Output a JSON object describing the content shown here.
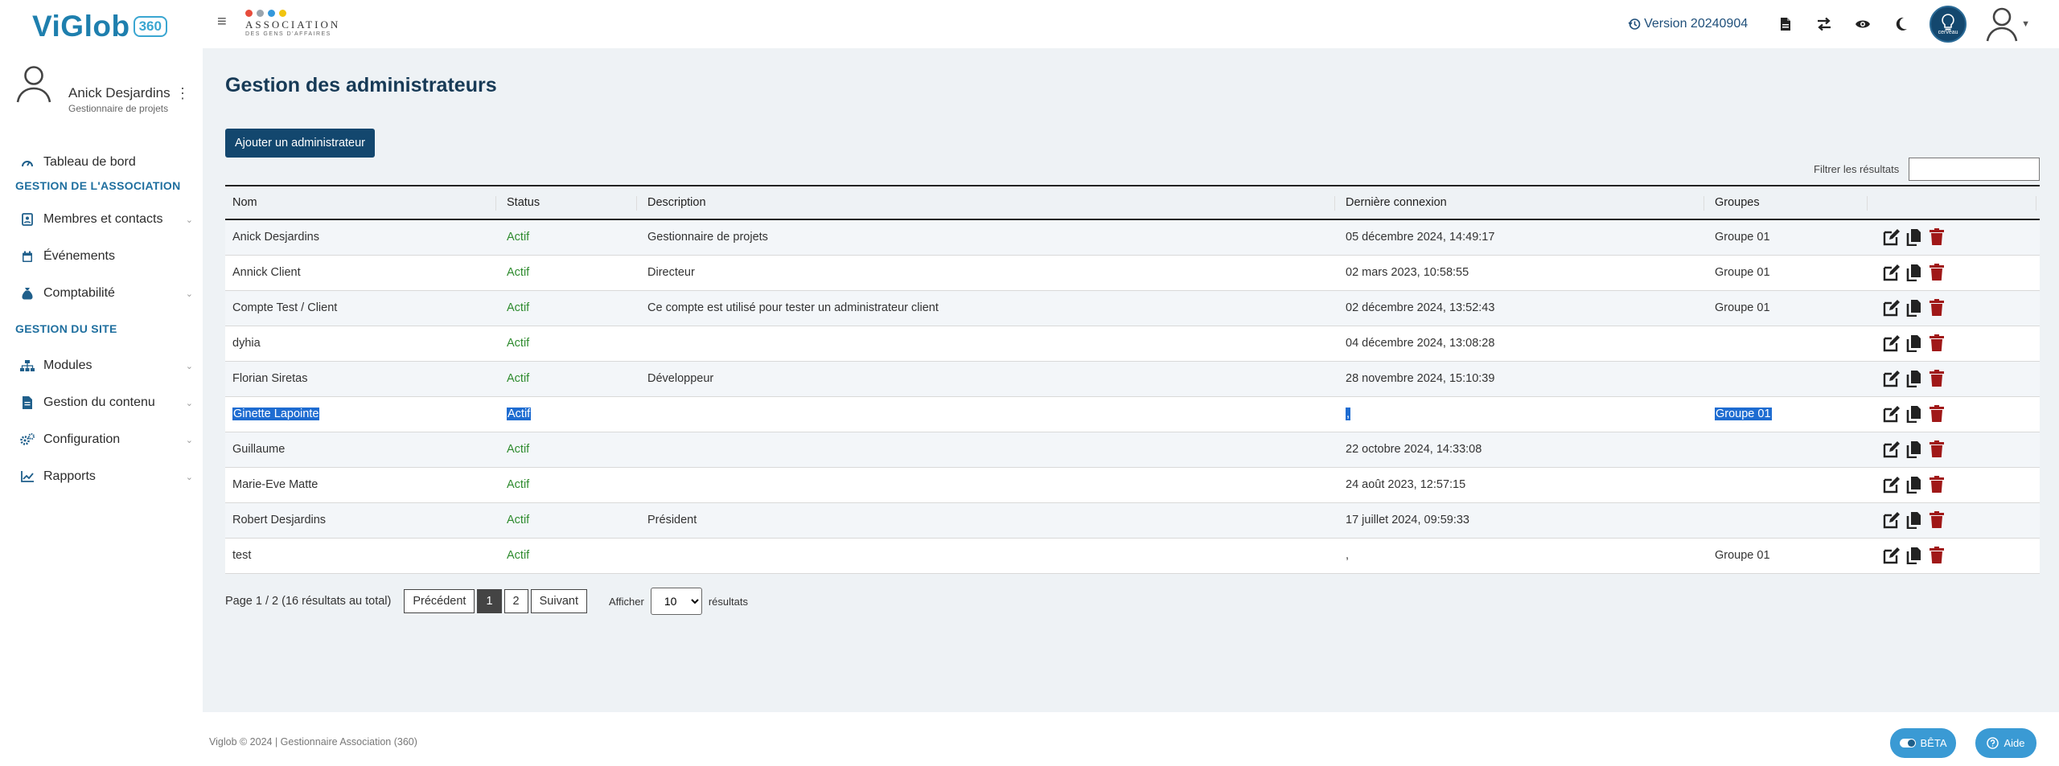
{
  "header": {
    "logo_text": "ViGlob",
    "logo_badge": "360",
    "assoc_name": "ASSOCIATION",
    "assoc_sub": "DES GENS D'AFFAIRES",
    "version": "Version 20240904",
    "cerveau_label": "cerveau",
    "dot_colors": [
      "#e74c3c",
      "#9aa4ad",
      "#3498db",
      "#f1c40f"
    ]
  },
  "sidebar": {
    "user_name": "Anick Desjardins",
    "user_role": "Gestionnaire de projets",
    "items": [
      {
        "label": "Tableau de bord",
        "icon": "gauge-icon"
      },
      {
        "label": "Membres et contacts",
        "icon": "contact-card-icon"
      },
      {
        "label": "Événements",
        "icon": "calendar-icon"
      },
      {
        "label": "Comptabilité",
        "icon": "money-bag-icon"
      },
      {
        "label": "Modules",
        "icon": "sitemap-icon"
      },
      {
        "label": "Gestion du contenu",
        "icon": "file-icon"
      },
      {
        "label": "Configuration",
        "icon": "cogs-icon"
      },
      {
        "label": "Rapports",
        "icon": "chart-line-icon"
      }
    ],
    "sections": [
      "GESTION DE L'ASSOCIATION",
      "GESTION DU SITE"
    ]
  },
  "main": {
    "title": "Gestion des administrateurs",
    "add_button": "Ajouter un administrateur",
    "filter_label": "Filtrer les résultats",
    "filter_value": "",
    "columns": [
      "Nom",
      "Status",
      "Description",
      "Dernière connexion",
      "Groupes"
    ],
    "rows": [
      {
        "nom": "Anick Desjardins",
        "status": "Actif",
        "description": "Gestionnaire de projets",
        "connexion": "05 décembre 2024, 14:49:17",
        "groupes": "Groupe 01"
      },
      {
        "nom": "Annick Client",
        "status": "Actif",
        "description": "Directeur",
        "connexion": "02 mars 2023, 10:58:55",
        "groupes": "Groupe 01"
      },
      {
        "nom": "Compte Test / Client",
        "status": "Actif",
        "description": "Ce compte est utilisé pour tester un administrateur client",
        "connexion": "02 décembre 2024, 13:52:43",
        "groupes": "Groupe 01"
      },
      {
        "nom": "dyhia",
        "status": "Actif",
        "description": "",
        "connexion": "04 décembre 2024, 13:08:28",
        "groupes": ""
      },
      {
        "nom": "Florian Siretas",
        "status": "Actif",
        "description": "Développeur",
        "connexion": "28 novembre 2024, 15:10:39",
        "groupes": ""
      },
      {
        "nom": "Ginette Lapointe",
        "status": "Actif",
        "description": "",
        "connexion": ",",
        "groupes": "Groupe 01"
      },
      {
        "nom": "Guillaume",
        "status": "Actif",
        "description": "",
        "connexion": "22 octobre 2024, 14:33:08",
        "groupes": ""
      },
      {
        "nom": "Marie-Eve Matte",
        "status": "Actif",
        "description": "",
        "connexion": "24 août 2023, 12:57:15",
        "groupes": ""
      },
      {
        "nom": "Robert Desjardins",
        "status": "Actif",
        "description": "Président",
        "connexion": "17 juillet 2024, 09:59:33",
        "groupes": ""
      },
      {
        "nom": "test",
        "status": "Actif",
        "description": "",
        "connexion": ",",
        "groupes": "Groupe 01"
      }
    ],
    "pagination": {
      "info": "Page 1 / 2 (16 résultats au total)",
      "prev": "Précédent",
      "pages": [
        "1",
        "2"
      ],
      "next": "Suivant",
      "show_label": "Afficher",
      "per_page": "10",
      "results_label": "résultats"
    }
  },
  "footer": {
    "copyright": "Viglob © 2024 | Gestionnaire Association (360)",
    "beta": "BÊTA",
    "help": "Aide"
  },
  "colors": {
    "brand": "#13476e",
    "accent": "#1f6f9f",
    "status_active": "#2e8b2e",
    "delete": "#a01818",
    "selection": "#1e6cd1"
  }
}
